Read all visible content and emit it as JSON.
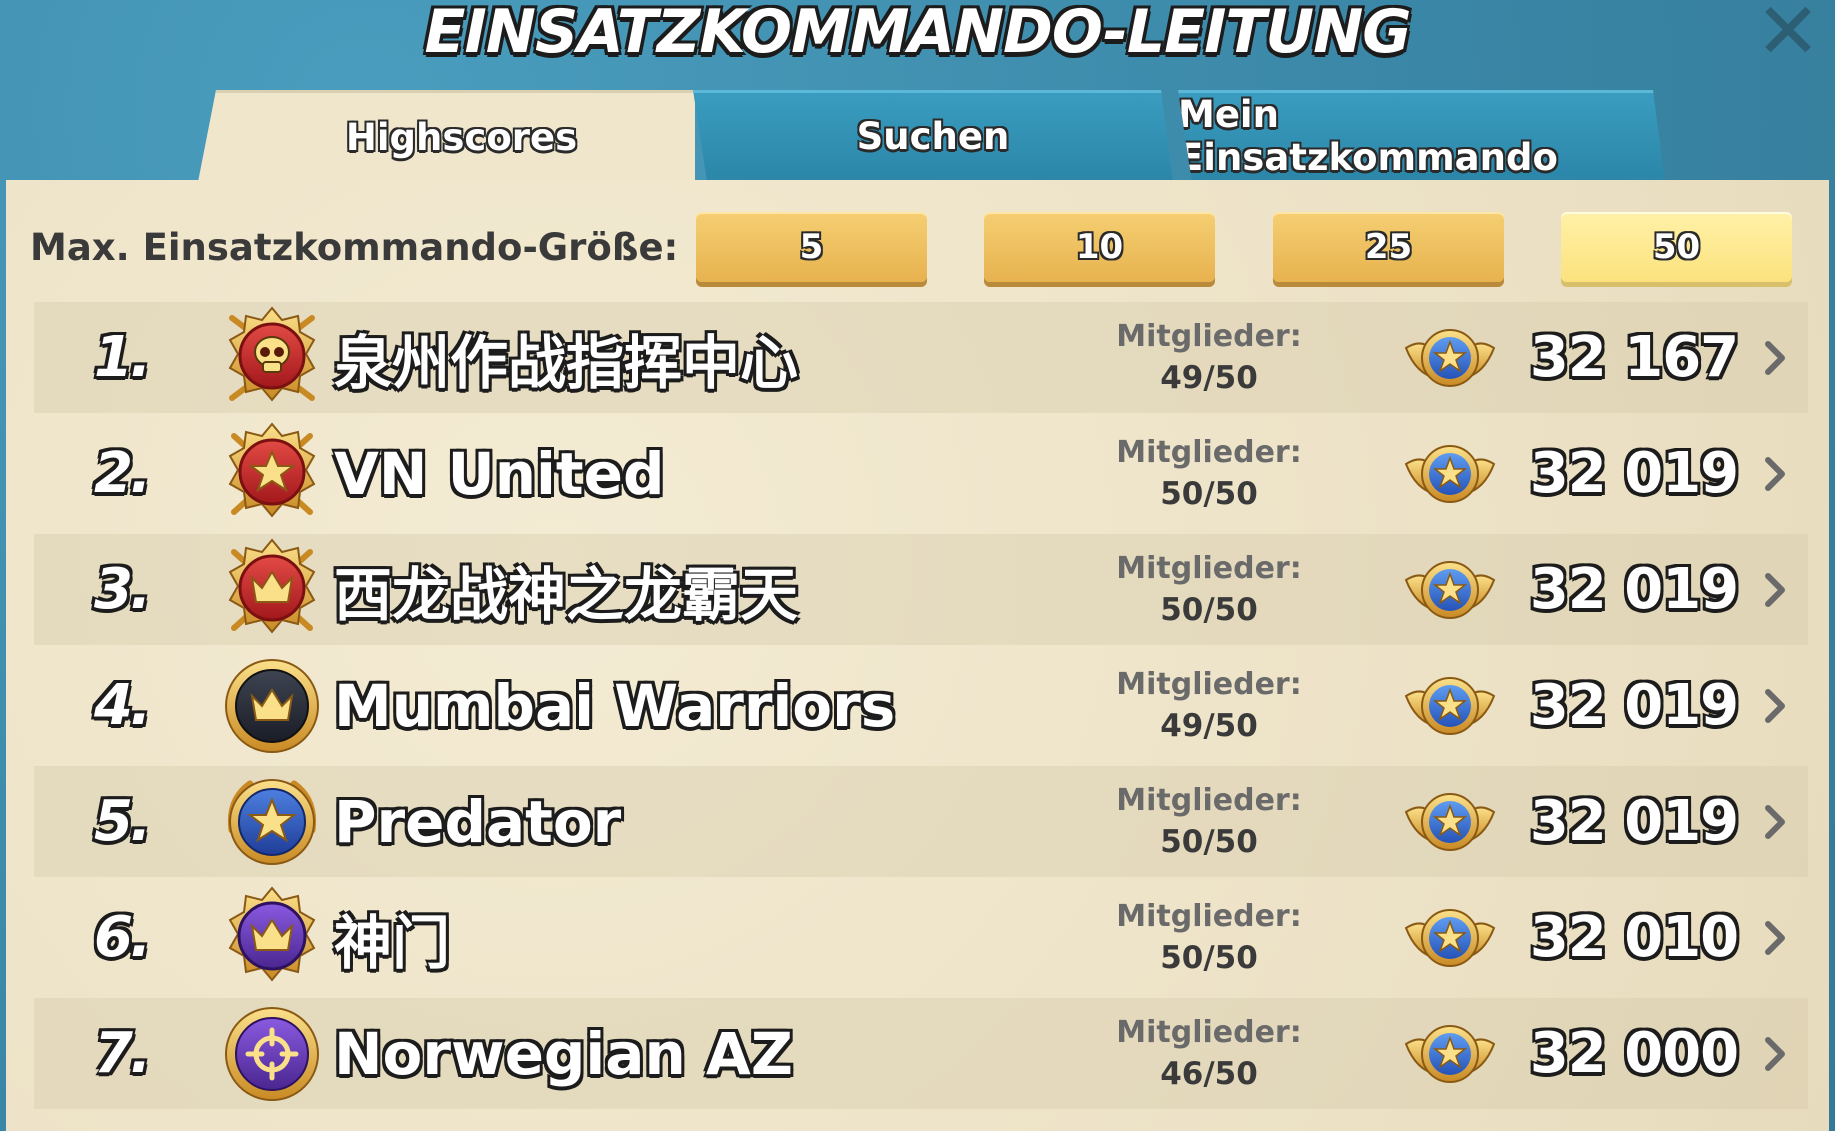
{
  "window": {
    "title": "EINSATZKOMMANDO-LEITUNG",
    "close_icon": "close-icon"
  },
  "tabs": [
    {
      "label": "Highscores",
      "active": true
    },
    {
      "label": "Suchen",
      "active": false
    },
    {
      "label": "Mein Einsatzkommando",
      "active": false
    }
  ],
  "filter": {
    "label": "Max. Einsatzkommando-Größe:",
    "options": [
      "5",
      "10",
      "25",
      "50"
    ],
    "selected": "50"
  },
  "members_label": "Mitglieder:",
  "rows": [
    {
      "rank": "1.",
      "name": "泉州作战指挥中心",
      "emblem": "skull-emblem-icon",
      "members": "49/50",
      "score": "32 167"
    },
    {
      "rank": "2.",
      "name": "VN United",
      "emblem": "star-emblem-icon",
      "members": "50/50",
      "score": "32 019"
    },
    {
      "rank": "3.",
      "name": "西龙战神之龙霸天",
      "emblem": "crown-emblem-icon",
      "members": "50/50",
      "score": "32 019"
    },
    {
      "rank": "4.",
      "name": "Mumbai Warriors",
      "emblem": "crown-emblem-icon",
      "members": "49/50",
      "score": "32 019"
    },
    {
      "rank": "5.",
      "name": "Predator",
      "emblem": "star-emblem-icon",
      "members": "50/50",
      "score": "32 019"
    },
    {
      "rank": "6.",
      "name": "神门",
      "emblem": "crown-emblem-icon",
      "members": "50/50",
      "score": "32 010"
    },
    {
      "rank": "7.",
      "name": "Norwegian AZ",
      "emblem": "crosshair-emblem-icon",
      "members": "46/50",
      "score": "32 000"
    }
  ],
  "colors": {
    "background": "#3f8fb0",
    "panel": "#efe6cc",
    "button": "#e7b24f",
    "button_selected": "#fbe27e"
  }
}
